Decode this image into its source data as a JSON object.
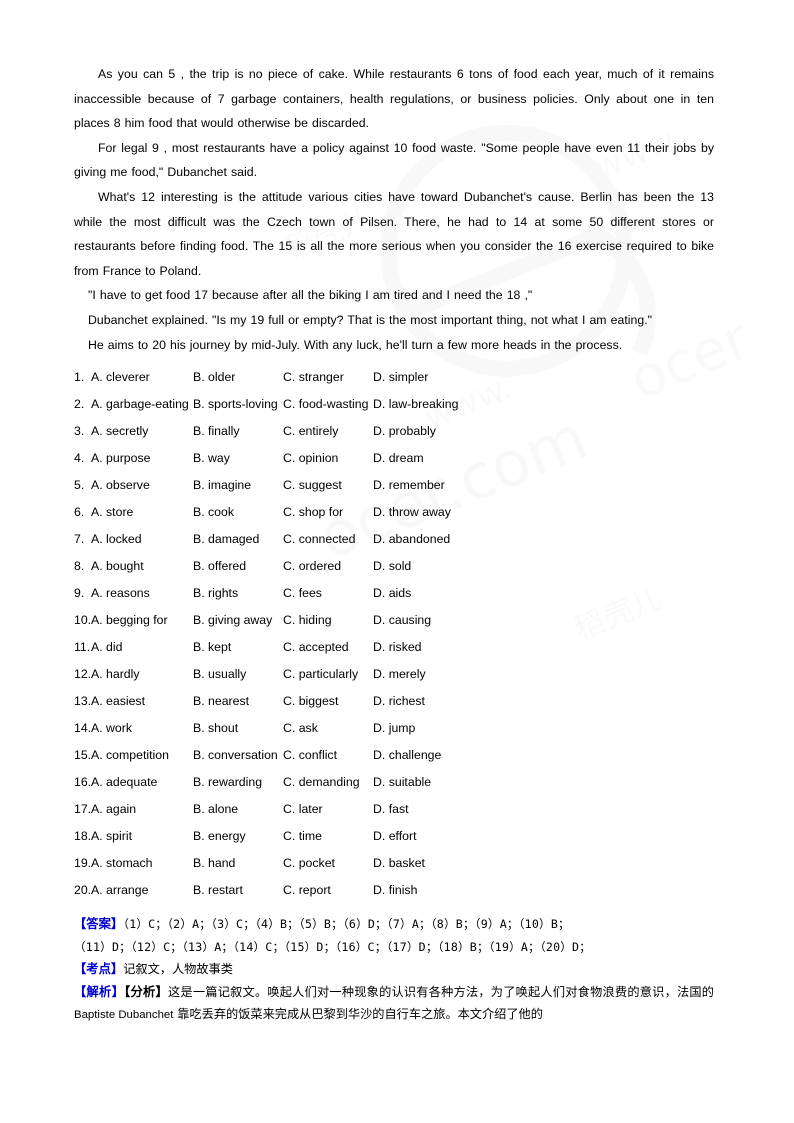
{
  "document": {
    "type": "english-cloze-test-worksheet",
    "background_color": "#ffffff",
    "text_color": "#000000",
    "accent_color": "#0000d4"
  },
  "watermark": {
    "text": "ocer.com",
    "secondary_text": "www.",
    "logo_text": "稻壳儿",
    "color": "#e8e8e8"
  },
  "passage": {
    "paragraphs": [
      "As you can 5 , the trip is no piece of cake. While restaurants 6 tons of food each year, much of it remains inaccessible because of 7 garbage containers, health regulations, or business policies. Only about one in ten places 8 him food that would otherwise be discarded.",
      "For legal 9 , most restaurants have a policy against 10 food waste. \"Some people have even 11 their jobs by giving me food,\" Dubanchet said.",
      "What's 12 interesting is the attitude various cities have toward Dubanchet's cause. Berlin has been the 13 while the most difficult was the Czech town of Pilsen. There, he had to 14 at some 50 different stores or restaurants before finding food. The 15 is all the more serious when you consider the 16 exercise required to bike from France to Poland.",
      "\"I have to get food 17 because after all the biking I am tired and I need the 18 ,\"",
      "Dubanchet explained. \"Is my 19 full or empty? That is the most important thing, not what I am eating.\"",
      "He aims to 20 his journey by mid-July. With any luck, he'll turn a few more heads in the process."
    ]
  },
  "options": {
    "rows": [
      {
        "num": "1.",
        "a": "A. cleverer",
        "b": "B. older",
        "c": "C. stranger",
        "d": "D. simpler"
      },
      {
        "num": "2.",
        "a": "A. garbage-eating",
        "b": "B. sports-loving",
        "c": "C. food-wasting",
        "d": "D. law-breaking"
      },
      {
        "num": "3.",
        "a": "A. secretly",
        "b": "B. finally",
        "c": "C. entirely",
        "d": "D. probably"
      },
      {
        "num": "4.",
        "a": "A. purpose",
        "b": "B. way",
        "c": "C. opinion",
        "d": "D. dream"
      },
      {
        "num": "5.",
        "a": "A. observe",
        "b": "B. imagine",
        "c": "C. suggest",
        "d": "D. remember"
      },
      {
        "num": "6.",
        "a": "A. store",
        "b": "B. cook",
        "c": "C. shop for",
        "d": "D. throw away"
      },
      {
        "num": "7.",
        "a": "A. locked",
        "b": "B. damaged",
        "c": "C. connected",
        "d": "D. abandoned"
      },
      {
        "num": "8.",
        "a": "A. bought",
        "b": "B. offered",
        "c": "C. ordered",
        "d": "D. sold"
      },
      {
        "num": "9.",
        "a": "A. reasons",
        "b": "B. rights",
        "c": "C. fees",
        "d": "D. aids"
      },
      {
        "num": "10.",
        "a": "A. begging for",
        "b": "B. giving away",
        "c": "C. hiding",
        "d": "D. causing"
      },
      {
        "num": "11.",
        "a": "A. did",
        "b": "B. kept",
        "c": "C. accepted",
        "d": "D. risked"
      },
      {
        "num": "12.",
        "a": "A. hardly",
        "b": "B. usually",
        "c": "C. particularly",
        "d": "D. merely"
      },
      {
        "num": "13.",
        "a": "A. easiest",
        "b": "B. nearest",
        "c": "C. biggest",
        "d": "D. richest"
      },
      {
        "num": "14.",
        "a": "A. work",
        "b": "B. shout",
        "c": "C. ask",
        "d": "D. jump"
      },
      {
        "num": "15.",
        "a": "A. competition",
        "b": "B. conversation",
        "c": "C. conflict",
        "d": "D. challenge"
      },
      {
        "num": "16.",
        "a": "A. adequate",
        "b": "B. rewarding",
        "c": "C. demanding",
        "d": "D. suitable"
      },
      {
        "num": "17.",
        "a": "A. again",
        "b": "B. alone",
        "c": "C. later",
        "d": "D. fast"
      },
      {
        "num": "18.",
        "a": "A. spirit",
        "b": "B. energy",
        "c": "C. time",
        "d": "D. effort"
      },
      {
        "num": "19.",
        "a": "A. stomach",
        "b": "B. hand",
        "c": "C. pocket",
        "d": "D. basket"
      },
      {
        "num": "20.",
        "a": "A. arrange",
        "b": "B. restart",
        "c": "C. report",
        "d": "D. finish"
      }
    ]
  },
  "answer_section": {
    "answer_tag": "【答案】",
    "answer_line_1": "（1）C；（2）A；（3）C；（4）B；（5）B；（6）D；（7）A；（8）B；（9）A；（10）B；",
    "answer_line_2": "（11）D；（12）C；（13）A；（14）C；（15）D；（16）C；（17）D；（18）B；（19）A；（20）D；",
    "answers": [
      {
        "n": "1",
        "v": "C"
      },
      {
        "n": "2",
        "v": "A"
      },
      {
        "n": "3",
        "v": "C"
      },
      {
        "n": "4",
        "v": "B"
      },
      {
        "n": "5",
        "v": "B"
      },
      {
        "n": "6",
        "v": "D"
      },
      {
        "n": "7",
        "v": "A"
      },
      {
        "n": "8",
        "v": "B"
      },
      {
        "n": "9",
        "v": "A"
      },
      {
        "n": "10",
        "v": "B"
      },
      {
        "n": "11",
        "v": "D"
      },
      {
        "n": "12",
        "v": "C"
      },
      {
        "n": "13",
        "v": "A"
      },
      {
        "n": "14",
        "v": "C"
      },
      {
        "n": "15",
        "v": "D"
      },
      {
        "n": "16",
        "v": "C"
      },
      {
        "n": "17",
        "v": "D"
      },
      {
        "n": "18",
        "v": "B"
      },
      {
        "n": "19",
        "v": "A"
      },
      {
        "n": "20",
        "v": "D"
      }
    ],
    "kaodian_tag": "【考点】",
    "kaodian_text": "记叙文，人物故事类",
    "jiexi_tag": "【解析】",
    "fenxi_tag": "【分析】",
    "analysis_part1": "这是一篇记叙文。唤起人们对一种现象的认识有各种方法，为了唤起人们对食物浪费的意识，法国的 ",
    "analysis_name": "Baptiste Dubanchet",
    "analysis_part2": " 靠吃丢弃的饭菜来完成从巴黎到华沙的自行车之旅。本文介绍了他的"
  }
}
